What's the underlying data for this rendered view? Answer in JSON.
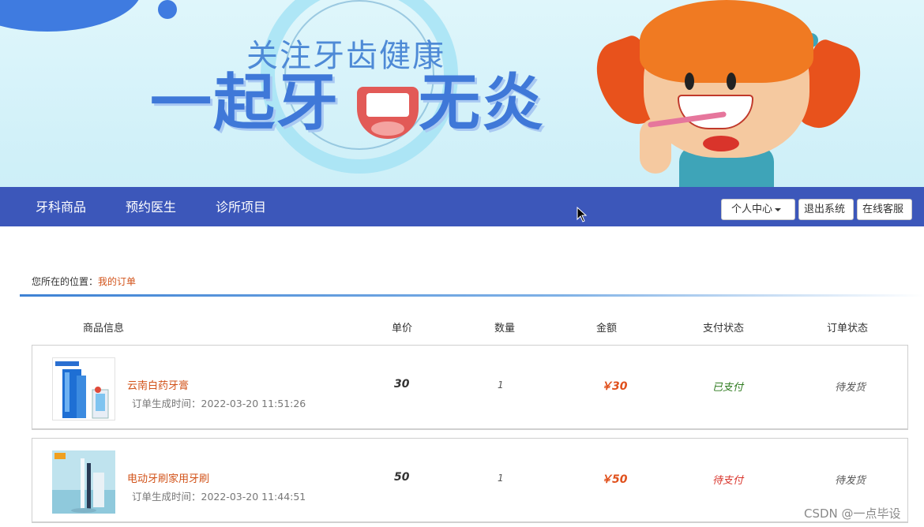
{
  "banner": {
    "slogan_top": "关注牙齿健康",
    "slogan_main_left": "一起牙",
    "slogan_main_right": "无炎"
  },
  "nav": {
    "items": [
      "牙科商品",
      "预约医生",
      "诊所项目"
    ],
    "personal_center": "个人中心",
    "logout": "退出系统",
    "online_service": "在线客服",
    "bar_color": "#3c57ba"
  },
  "breadcrumb": {
    "prefix": "您所在的位置：",
    "current": "我的订单"
  },
  "table": {
    "headers": {
      "product": "商品信息",
      "unit_price": "单价",
      "quantity": "数量",
      "amount": "金额",
      "pay_status": "支付状态",
      "order_status": "订单状态"
    },
    "rows": [
      {
        "name": "云南白药牙膏",
        "time": "订单生成时间：2022-03-20 11:51:26",
        "price": "30",
        "qty": "1",
        "amount": "￥30",
        "pay_status": "已支付",
        "order_status": "待发货"
      },
      {
        "name": "电动牙刷家用牙刷",
        "time": "订单生成时间：2022-03-20 11:44:51",
        "price": "50",
        "qty": "1",
        "amount": "￥50",
        "pay_status": "待支付",
        "order_status": "待发货"
      }
    ]
  },
  "watermark": "CSDN @一点毕设"
}
